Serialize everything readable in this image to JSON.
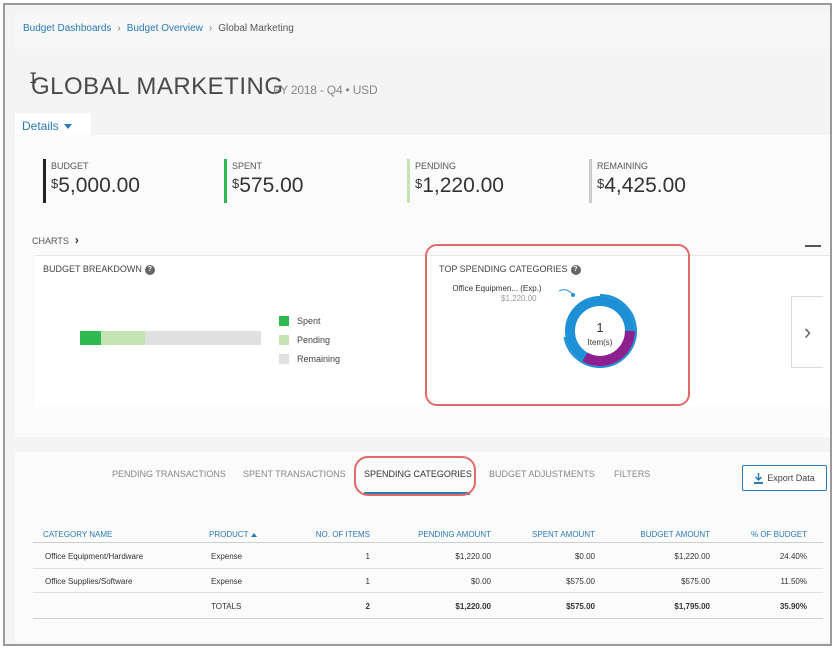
{
  "breadcrumb": {
    "items": [
      "Budget Dashboards",
      "Budget Overview"
    ],
    "current": "Global Marketing"
  },
  "header": {
    "title": "GLOBAL MARKETING",
    "subtitle": "FY 2018 - Q4 • USD",
    "details_label": "Details"
  },
  "kpis": [
    {
      "label": "BUDGET",
      "currency": "$",
      "amount": "5,000.00",
      "color": "#222222"
    },
    {
      "label": "SPENT",
      "currency": "$",
      "amount": "575.00",
      "color": "#2fba4f"
    },
    {
      "label": "PENDING",
      "currency": "$",
      "amount": "1,220.00",
      "color": "#c4e4b2"
    },
    {
      "label": "REMAINING",
      "currency": "$",
      "amount": "4,425.00",
      "color": "#cccccc"
    }
  ],
  "charts": {
    "toggle_label": "CHARTS",
    "budget_breakdown": {
      "title": "BUDGET BREAKDOWN",
      "total": 5000,
      "spent": 575,
      "pending": 1220,
      "legend": [
        {
          "label": "Spent",
          "color": "#2fba4f"
        },
        {
          "label": "Pending",
          "color": "#c4e4b2"
        },
        {
          "label": "Remaining",
          "color": "#e0e0e0"
        }
      ]
    },
    "top_spending": {
      "title": "TOP SPENDING CATEGORIES",
      "callout_label": "Office Equipmen... (Exp.)",
      "callout_value": "$1,220.00",
      "center_value": "1",
      "center_label": "Item(s)",
      "outer_color": "#1e90d6",
      "inner_color": "#8e1f8e"
    }
  },
  "tabs": [
    {
      "label": "PENDING TRANSACTIONS",
      "active": false
    },
    {
      "label": "SPENT TRANSACTIONS",
      "active": false
    },
    {
      "label": "SPENDING CATEGORIES",
      "active": true
    },
    {
      "label": "BUDGET ADJUSTMENTS",
      "active": false
    },
    {
      "label": "FILTERS",
      "active": false
    }
  ],
  "export_label": "Export Data",
  "table": {
    "columns": [
      "CATEGORY NAME",
      "PRODUCT",
      "NO. OF ITEMS",
      "PENDING AMOUNT",
      "SPENT AMOUNT",
      "BUDGET AMOUNT",
      "% OF BUDGET"
    ],
    "rows": [
      [
        "Office Equipment/Hardware",
        "Expense",
        "1",
        "$1,220.00",
        "$0.00",
        "$1,220.00",
        "24.40%"
      ],
      [
        "Office Supplies/Software",
        "Expense",
        "1",
        "$0.00",
        "$575.00",
        "$575.00",
        "11.50%"
      ]
    ],
    "totals": [
      "TOTALS",
      "2",
      "$1,220.00",
      "$575.00",
      "$1,795.00",
      "35.90%"
    ]
  }
}
